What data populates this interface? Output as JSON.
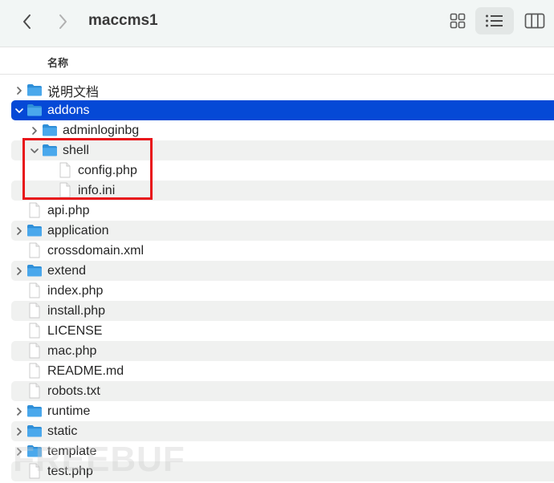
{
  "toolbar": {
    "title": "maccms1",
    "back_icon": "chevron-left-icon",
    "forward_icon": "chevron-right-icon",
    "views": [
      {
        "name": "icon-view",
        "icon": "grid-icon",
        "active": false
      },
      {
        "name": "list-view",
        "icon": "list-icon",
        "active": true
      },
      {
        "name": "column-view",
        "icon": "columns-icon",
        "active": false
      }
    ]
  },
  "header": {
    "name_column": "名称"
  },
  "colors": {
    "selection": "#0549d6",
    "folder": "#4aa8ec",
    "highlight_box": "#e8141a",
    "stripe": "#f0f1f0"
  },
  "files": [
    {
      "name": "说明文档",
      "type": "folder",
      "level": 0,
      "expanded": false
    },
    {
      "name": "addons",
      "type": "folder",
      "level": 0,
      "expanded": true,
      "selected": true
    },
    {
      "name": "adminloginbg",
      "type": "folder",
      "level": 1,
      "expanded": false
    },
    {
      "name": "shell",
      "type": "folder",
      "level": 1,
      "expanded": true
    },
    {
      "name": "config.php",
      "type": "file",
      "level": 2
    },
    {
      "name": "info.ini",
      "type": "file",
      "level": 2
    },
    {
      "name": "api.php",
      "type": "file",
      "level": 0
    },
    {
      "name": "application",
      "type": "folder",
      "level": 0,
      "expanded": false
    },
    {
      "name": "crossdomain.xml",
      "type": "file",
      "level": 0
    },
    {
      "name": "extend",
      "type": "folder",
      "level": 0,
      "expanded": false
    },
    {
      "name": "index.php",
      "type": "file",
      "level": 0
    },
    {
      "name": "install.php",
      "type": "file",
      "level": 0
    },
    {
      "name": "LICENSE",
      "type": "file",
      "level": 0
    },
    {
      "name": "mac.php",
      "type": "file",
      "level": 0
    },
    {
      "name": "README.md",
      "type": "file",
      "level": 0
    },
    {
      "name": "robots.txt",
      "type": "file",
      "level": 0
    },
    {
      "name": "runtime",
      "type": "folder",
      "level": 0,
      "expanded": false
    },
    {
      "name": "static",
      "type": "folder",
      "level": 0,
      "expanded": false
    },
    {
      "name": "template",
      "type": "folder",
      "level": 0,
      "expanded": false
    },
    {
      "name": "test.php",
      "type": "file",
      "level": 0
    }
  ],
  "watermark": "FREEBUF"
}
